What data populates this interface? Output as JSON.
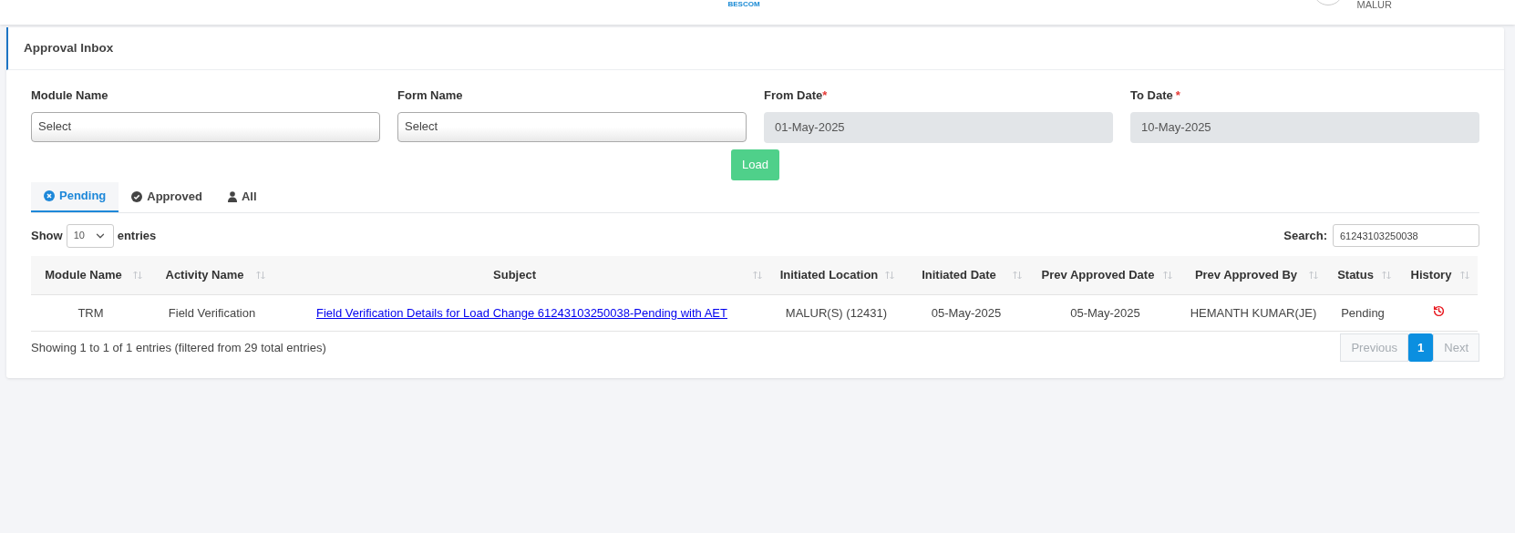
{
  "header": {
    "logo_text": "BESCOM",
    "user_location": "MALUR"
  },
  "card": {
    "title": "Approval Inbox"
  },
  "filters": [
    {
      "kind": "select",
      "label": "Module Name",
      "value": "Select"
    },
    {
      "kind": "select",
      "label": "Form Name",
      "value": "Select"
    },
    {
      "kind": "date",
      "label": "From Date",
      "required_mark": "*",
      "value": "01-May-2025"
    },
    {
      "kind": "date",
      "label": "To Date",
      "required_mark": "*",
      "value": "10-May-2025"
    }
  ],
  "load_button": "Load",
  "tabs": [
    {
      "label": "Pending",
      "kind": "pending",
      "selected": true
    },
    {
      "label": "Approved",
      "kind": "approved",
      "selected": false
    },
    {
      "label": "All",
      "kind": "all",
      "selected": false
    }
  ],
  "length": {
    "before": "Show",
    "value": "10",
    "after": "entries"
  },
  "search": {
    "label": "Search:",
    "value": "61243103250038"
  },
  "table": {
    "columns": [
      "Module Name",
      "Activity Name",
      "Subject",
      "Initiated Location",
      "Initiated Date",
      "Prev Approved Date",
      "Prev Approved By",
      "Status",
      "History"
    ],
    "rows": [
      {
        "module": "TRM",
        "activity": "Field Verification",
        "subject": "Field Verification Details for Load Change 61243103250038-Pending with AET",
        "location": "MALUR(S) (12431)",
        "initiated_date": "05-May-2025",
        "prev_approved_date": "05-May-2025",
        "prev_approved_by": "HEMANTH KUMAR(JE)",
        "status": "Pending"
      }
    ]
  },
  "info": "Showing 1 to 1 of 1 entries (filtered from 29 total entries)",
  "pagination": [
    {
      "label": "Previous",
      "disabled": true,
      "selected": false
    },
    {
      "label": "1",
      "disabled": false,
      "selected": true
    },
    {
      "label": "Next",
      "disabled": true,
      "selected": false
    }
  ]
}
